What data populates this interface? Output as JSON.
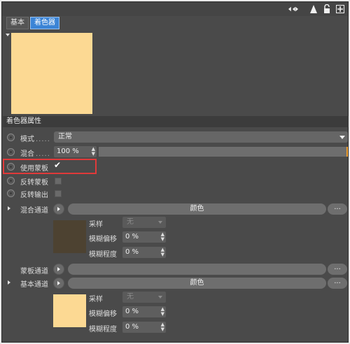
{
  "tabs": [
    {
      "label": "基本"
    },
    {
      "label": "着色器"
    }
  ],
  "topbar_icons": [
    "nav-arrows-icon",
    "pointer-up-icon",
    "lock-icon",
    "add-panel-icon"
  ],
  "preview_color": "#fcd993",
  "section_title": "着色器属性",
  "mode": {
    "label": "模式",
    "dots": ".....",
    "value": "正常"
  },
  "blend": {
    "label": "混合",
    "dots": ".....",
    "value": "100 %",
    "level": 1.0
  },
  "use_mask": {
    "label": "使用蒙板",
    "checked": true,
    "check_mark": "✔"
  },
  "invert_mask": {
    "label": "反转蒙板",
    "checked": false
  },
  "invert_output": {
    "label": "反转输出",
    "checked": false
  },
  "channels": [
    {
      "label": "混合通道",
      "button_label": "颜色",
      "more_label": "...",
      "swatch_color": "#4d4231",
      "sampling_label": "采样",
      "sampling_value": "无",
      "blur_offset_label": "模糊偏移",
      "blur_offset_value": "0 %",
      "blur_scale_label": "模糊程度",
      "blur_scale_value": "0 %"
    },
    {
      "label": "蒙板通道",
      "button_label": "",
      "more_label": "..."
    },
    {
      "label": "基本通道",
      "button_label": "颜色",
      "more_label": "...",
      "swatch_color": "#fcd993",
      "sampling_label": "采样",
      "sampling_value": "无",
      "blur_offset_label": "模糊偏移",
      "blur_offset_value": "0 %",
      "blur_scale_label": "模糊程度",
      "blur_scale_value": "0 %"
    }
  ],
  "spin_glyph": "⬍",
  "highlight_color": "#e03a3a",
  "accent_color": "#3b84d6"
}
